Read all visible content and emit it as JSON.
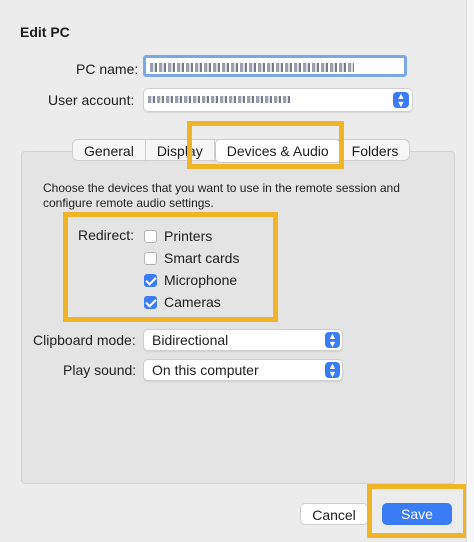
{
  "dialog": {
    "title": "Edit PC",
    "pc_name_label": "PC name:",
    "user_account_label": "User account:"
  },
  "tabs": [
    {
      "label": "General"
    },
    {
      "label": "Display"
    },
    {
      "label": "Devices & Audio"
    },
    {
      "label": "Folders"
    }
  ],
  "devices": {
    "description": "Choose the devices that you want to use in the remote session and configure remote audio settings.",
    "redirect_label": "Redirect:",
    "items": [
      {
        "label": "Printers",
        "checked": false
      },
      {
        "label": "Smart cards",
        "checked": false
      },
      {
        "label": "Microphone",
        "checked": true
      },
      {
        "label": "Cameras",
        "checked": true
      }
    ],
    "clipboard_label": "Clipboard mode:",
    "clipboard_value": "Bidirectional",
    "sound_label": "Play sound:",
    "sound_value": "On this computer"
  },
  "footer": {
    "cancel_label": "Cancel",
    "save_label": "Save"
  },
  "colors": {
    "accent": "#3a7bf6",
    "highlight": "#f0b429"
  }
}
